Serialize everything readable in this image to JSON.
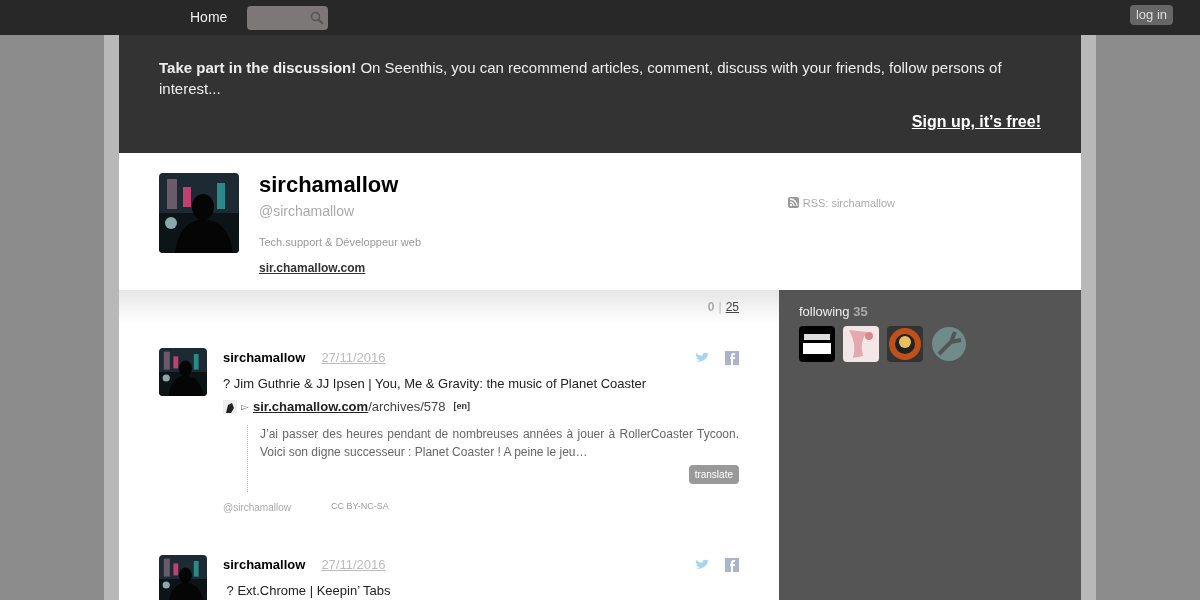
{
  "nav": {
    "home": "Home",
    "search": {
      "kind": "search"
    },
    "login": "log in"
  },
  "banner": {
    "text": "**Take part in the discussion!** On Seenthis, you can recommend articles, comment, discuss with your friends, follow persons of interest...",
    "signup": "Sign up, it’s free!"
  },
  "profile": {
    "name": "sirchamallow",
    "handle": "@sirchamallow",
    "bio": "Tech.support & Développeur web",
    "website": "sir.chamallow.com",
    "rss": "RSS: sirchamallow"
  },
  "pager": {
    "current": "0",
    "separator": "|",
    "next": "25"
  },
  "posts": [
    {
      "author": "sirchamallow",
      "date": "27/11/2016",
      "title": "? Jim Guthrie & JJ Ipsen | You, Me & Gravity: the music of Planet Coaster",
      "link_marker": "▻",
      "link_domain": "sir.chamallow.com",
      "link_path": "/archives/578",
      "lang": "[en]",
      "excerpt": "J’ai passer des heures pendant de nombreuses années à jouer à RollerCoaster Tycoon. Voici son digne successeur : Planet Coaster ! A peine le jeu…",
      "translate": "translate",
      "footer_handle": "@sirchamallow",
      "license": "CC BY-NC-SA"
    },
    {
      "author": "sirchamallow",
      "date": "27/11/2016",
      "title": " ? Ext.Chrome | Keepin’ Tabs"
    }
  ],
  "following": {
    "label": "following",
    "count": "35"
  }
}
